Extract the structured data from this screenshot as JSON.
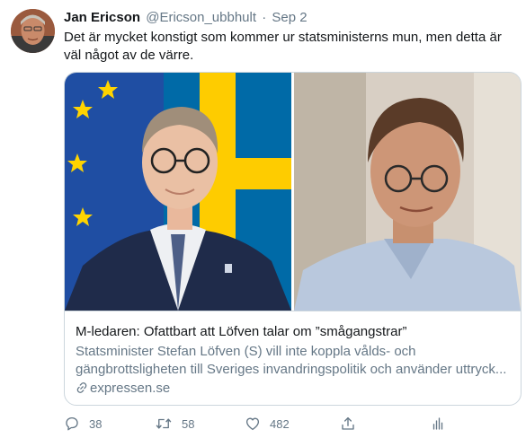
{
  "tweet": {
    "author_name": "Jan Ericson",
    "handle": "@Ericson_ubbhult",
    "separator": "·",
    "date": "Sep 2",
    "text": "Det är mycket konstigt som kommer ur statsministerns mun, men detta är väl något av de värre."
  },
  "card": {
    "title": "M-ledaren: Ofattbart att Löfven talar om ”smågangstrar”",
    "description_line1": "Statsminister Stefan Löfven (S) vill inte koppla vålds- och",
    "description_line2": "gängbrottsligheten till Sveriges invandringspolitik och använder uttryck...",
    "domain": "expressen.se"
  },
  "actions": {
    "reply_count": "38",
    "retweet_count": "58",
    "like_count": "482"
  },
  "colors": {
    "text_primary": "#14171a",
    "text_secondary": "#657786",
    "border": "#ccd6dd",
    "eu_flag_blue": "#1f4ea3",
    "eu_flag_stars": "#ffd400",
    "swedish_flag_blue": "#006aa7",
    "swedish_flag_yellow": "#fecc00"
  },
  "icons": [
    "avatar",
    "link-icon",
    "reply-icon",
    "retweet-icon",
    "like-icon",
    "share-icon",
    "analytics-icon"
  ]
}
